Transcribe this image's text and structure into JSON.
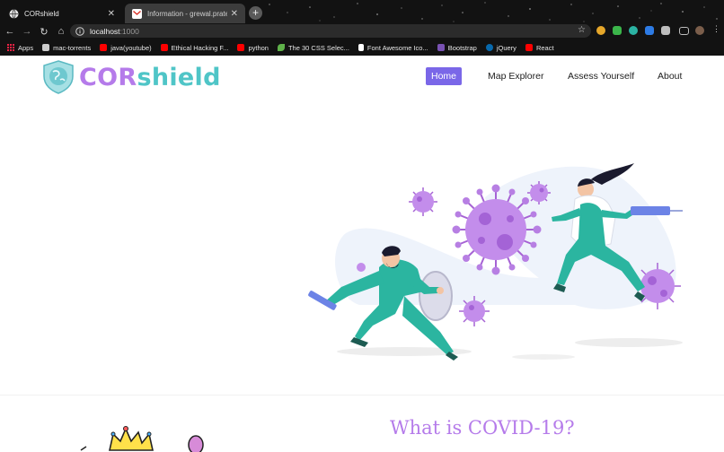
{
  "browser": {
    "tabs": [
      {
        "title": "CORshield",
        "active": true
      },
      {
        "title": "Information - grewal.pratesk10",
        "active": false
      }
    ],
    "url_host": "localhost",
    "url_port": ":1000",
    "bookmarks": [
      {
        "label": "Apps",
        "icon": "apps-grid-icon",
        "color": "#e8453c"
      },
      {
        "label": "mac-torrents",
        "icon": "page-icon",
        "color": "#cccccc"
      },
      {
        "label": "java(youtube)",
        "icon": "youtube-icon",
        "color": "#ff0000"
      },
      {
        "label": "Ethical Hacking F...",
        "icon": "youtube-icon",
        "color": "#ff0000"
      },
      {
        "label": "python",
        "icon": "youtube-icon",
        "color": "#ff0000"
      },
      {
        "label": "The 30 CSS Selec...",
        "icon": "leaf-icon",
        "color": "#5fb24a"
      },
      {
        "label": "Font Awesome Ico...",
        "icon": "flag-icon",
        "color": "#ffffff"
      },
      {
        "label": "Bootstrap",
        "icon": "bootstrap-icon",
        "color": "#7952b3"
      },
      {
        "label": "jQuery",
        "icon": "jquery-icon",
        "color": "#0769ad"
      },
      {
        "label": "React",
        "icon": "youtube-icon",
        "color": "#ff0000"
      }
    ]
  },
  "site": {
    "brand_part1": "COR",
    "brand_part2": "shield",
    "brand_color_1": "#b57bea",
    "brand_color_2": "#4fc5c7",
    "nav": {
      "home": "Home",
      "map": "Map Explorer",
      "assess": "Assess Yourself",
      "about": "About",
      "active_color": "#7a67e8"
    },
    "section_title": "What is COVID-19?"
  }
}
